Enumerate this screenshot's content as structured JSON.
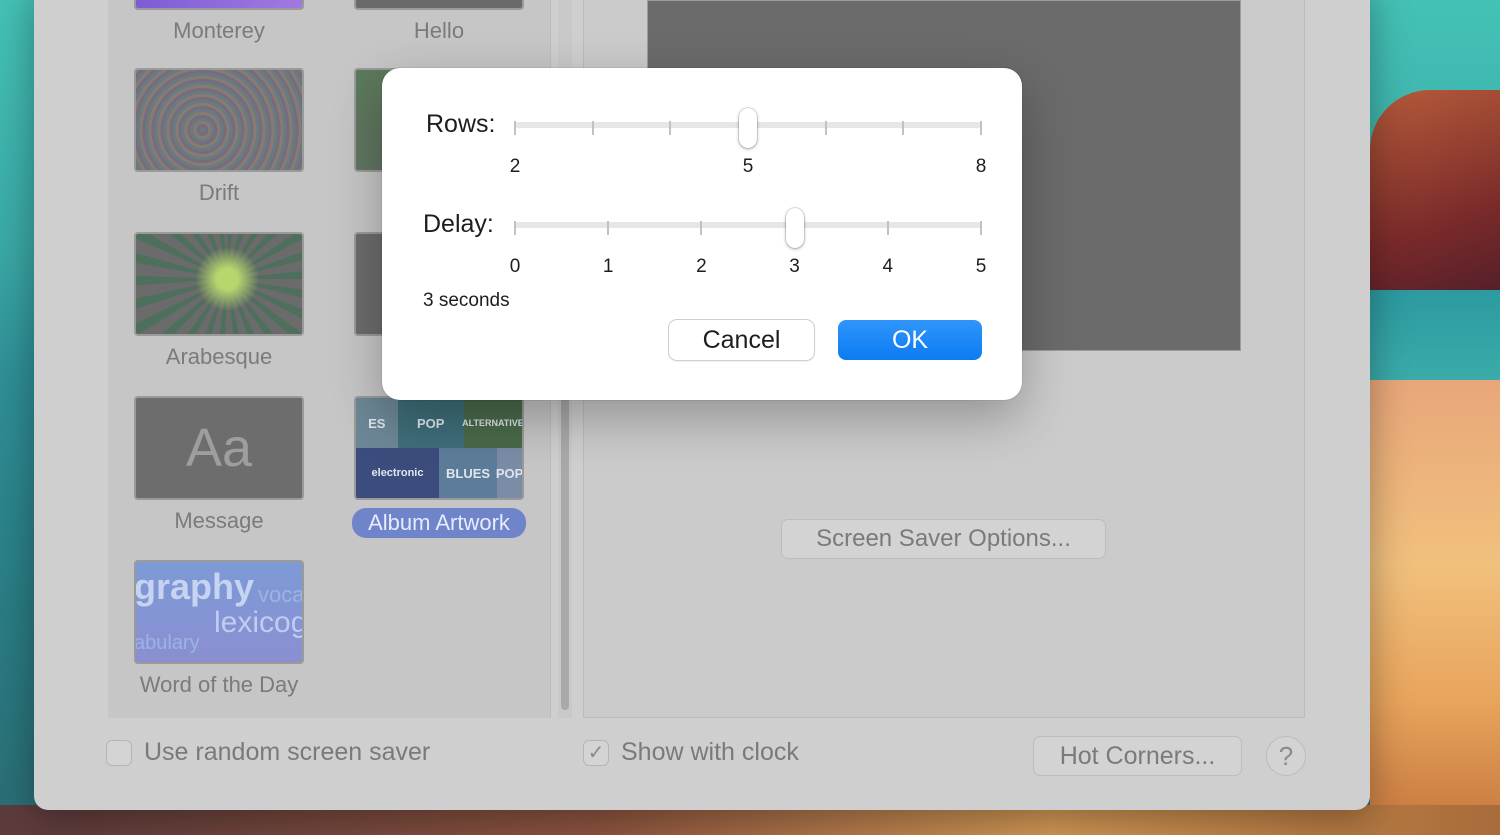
{
  "savers": [
    {
      "label": "Monterey"
    },
    {
      "label": "Hello"
    },
    {
      "label": "Drift"
    },
    {
      "label": "Arabesque"
    },
    {
      "label": "Message",
      "thumb_text": "Aa"
    },
    {
      "label": "Album Artwork",
      "selected": true,
      "tiles": [
        "ES",
        "POP",
        "ALTERNATIVE",
        "electronic",
        "BLUES",
        "POP"
      ]
    },
    {
      "label": "Word of the Day",
      "thumb_words": [
        "graphy",
        "voca",
        "lexicog",
        "abulary"
      ]
    }
  ],
  "preview": {
    "options_button": "Screen Saver Options..."
  },
  "footer": {
    "random_label": "Use random screen saver",
    "random_checked": false,
    "clock_label": "Show with clock",
    "clock_checked": true,
    "check_glyph": "✓",
    "hot_corners_button": "Hot Corners...",
    "help_button": "?"
  },
  "dialog": {
    "rows_label": "Rows:",
    "rows_value": 5,
    "rows_min": 2,
    "rows_max": 8,
    "rows_tick_labels": [
      "2",
      "5",
      "8"
    ],
    "delay_label": "Delay:",
    "delay_value": 3,
    "delay_min": 0,
    "delay_max": 5,
    "delay_tick_labels": [
      "0",
      "1",
      "2",
      "3",
      "4",
      "5"
    ],
    "delay_text": "3 seconds",
    "cancel_button": "Cancel",
    "ok_button": "OK"
  },
  "colors": {
    "accent": "#0c7cf2",
    "selection": "#6f84c9"
  }
}
